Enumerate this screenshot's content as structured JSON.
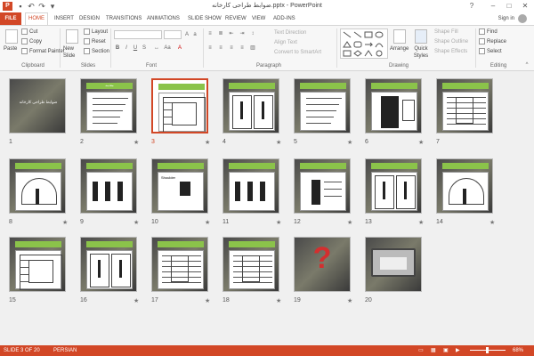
{
  "titlebar": {
    "app_badge": "P",
    "title": "ضوابط طراحی کارخانه.pptx - PowerPoint",
    "min": "–",
    "max": "□",
    "close": "✕",
    "help": "?"
  },
  "tabs": {
    "file": "FILE",
    "items": [
      "HOME",
      "INSERT",
      "DESIGN",
      "TRANSITIONS",
      "ANIMATIONS",
      "SLIDE SHOW",
      "REVIEW",
      "VIEW",
      "ADD-INS"
    ],
    "signin": "Sign in"
  },
  "ribbon": {
    "clipboard": {
      "paste": "Paste",
      "cut": "Cut",
      "copy": "Copy",
      "format_painter": "Format Painter",
      "label": "Clipboard"
    },
    "slides": {
      "new_slide": "New Slide",
      "layout": "Layout",
      "reset": "Reset",
      "section": "Section",
      "label": "Slides"
    },
    "font": {
      "label": "Font"
    },
    "paragraph": {
      "text_direction": "Text Direction",
      "align_text": "Align Text",
      "convert": "Convert to SmartArt",
      "label": "Paragraph"
    },
    "drawing": {
      "arrange": "Arrange",
      "quick_styles": "Quick Styles",
      "shape_fill": "Shape Fill",
      "shape_outline": "Shape Outline",
      "shape_effects": "Shape Effects",
      "label": "Drawing"
    },
    "editing": {
      "find": "Find",
      "replace": "Replace",
      "select": "Select",
      "label": "Editing"
    }
  },
  "slides": [
    {
      "n": "1",
      "star": "",
      "title": "ضوابط طراحی کارخانه",
      "kind": "title"
    },
    {
      "n": "2",
      "star": "★",
      "title": "مقدمه",
      "kind": "text"
    },
    {
      "n": "3",
      "star": "★",
      "title": "",
      "kind": "perspective",
      "selected": true
    },
    {
      "n": "4",
      "star": "★",
      "title": "",
      "kind": "drawings"
    },
    {
      "n": "5",
      "star": "★",
      "title": "",
      "kind": "text"
    },
    {
      "n": "6",
      "star": "★",
      "title": "",
      "kind": "machine"
    },
    {
      "n": "7",
      "star": "",
      "title": "",
      "kind": "plan"
    },
    {
      "n": "8",
      "star": "★",
      "title": "",
      "kind": "arc"
    },
    {
      "n": "9",
      "star": "★",
      "title": "",
      "kind": "figures"
    },
    {
      "n": "10",
      "star": "★",
      "title": "",
      "kind": "shoulder"
    },
    {
      "n": "11",
      "star": "★",
      "title": "",
      "kind": "figures"
    },
    {
      "n": "12",
      "star": "★",
      "title": "",
      "kind": "legs"
    },
    {
      "n": "13",
      "star": "★",
      "title": "",
      "kind": "drawings"
    },
    {
      "n": "14",
      "star": "★",
      "title": "",
      "kind": "arc"
    },
    {
      "n": "15",
      "star": "",
      "title": "",
      "kind": "perspective"
    },
    {
      "n": "16",
      "star": "★",
      "title": "",
      "kind": "drawings"
    },
    {
      "n": "17",
      "star": "★",
      "title": "",
      "kind": "plan"
    },
    {
      "n": "18",
      "star": "★",
      "title": "",
      "kind": "table"
    },
    {
      "n": "19",
      "star": "★",
      "title": "",
      "kind": "question"
    },
    {
      "n": "20",
      "star": "",
      "title": "",
      "kind": "laptop"
    }
  ],
  "slide_labels": {
    "shoulder": "Shoulder",
    "slide4_a": "Bent",
    "slide4_b": "Tilted",
    "shoulder_sub": "Lifting with elbows",
    "row9": [
      "Forward placement",
      "Side",
      "Sitting"
    ],
    "row11": [
      "Sitting",
      "Standing"
    ],
    "row12": [
      "75% adjustable",
      "90% adjustable",
      "95% adjustable"
    ]
  },
  "status": {
    "slide": "SLIDE 3 OF 20",
    "lang": "PERSIAN",
    "zoom": "68%"
  }
}
